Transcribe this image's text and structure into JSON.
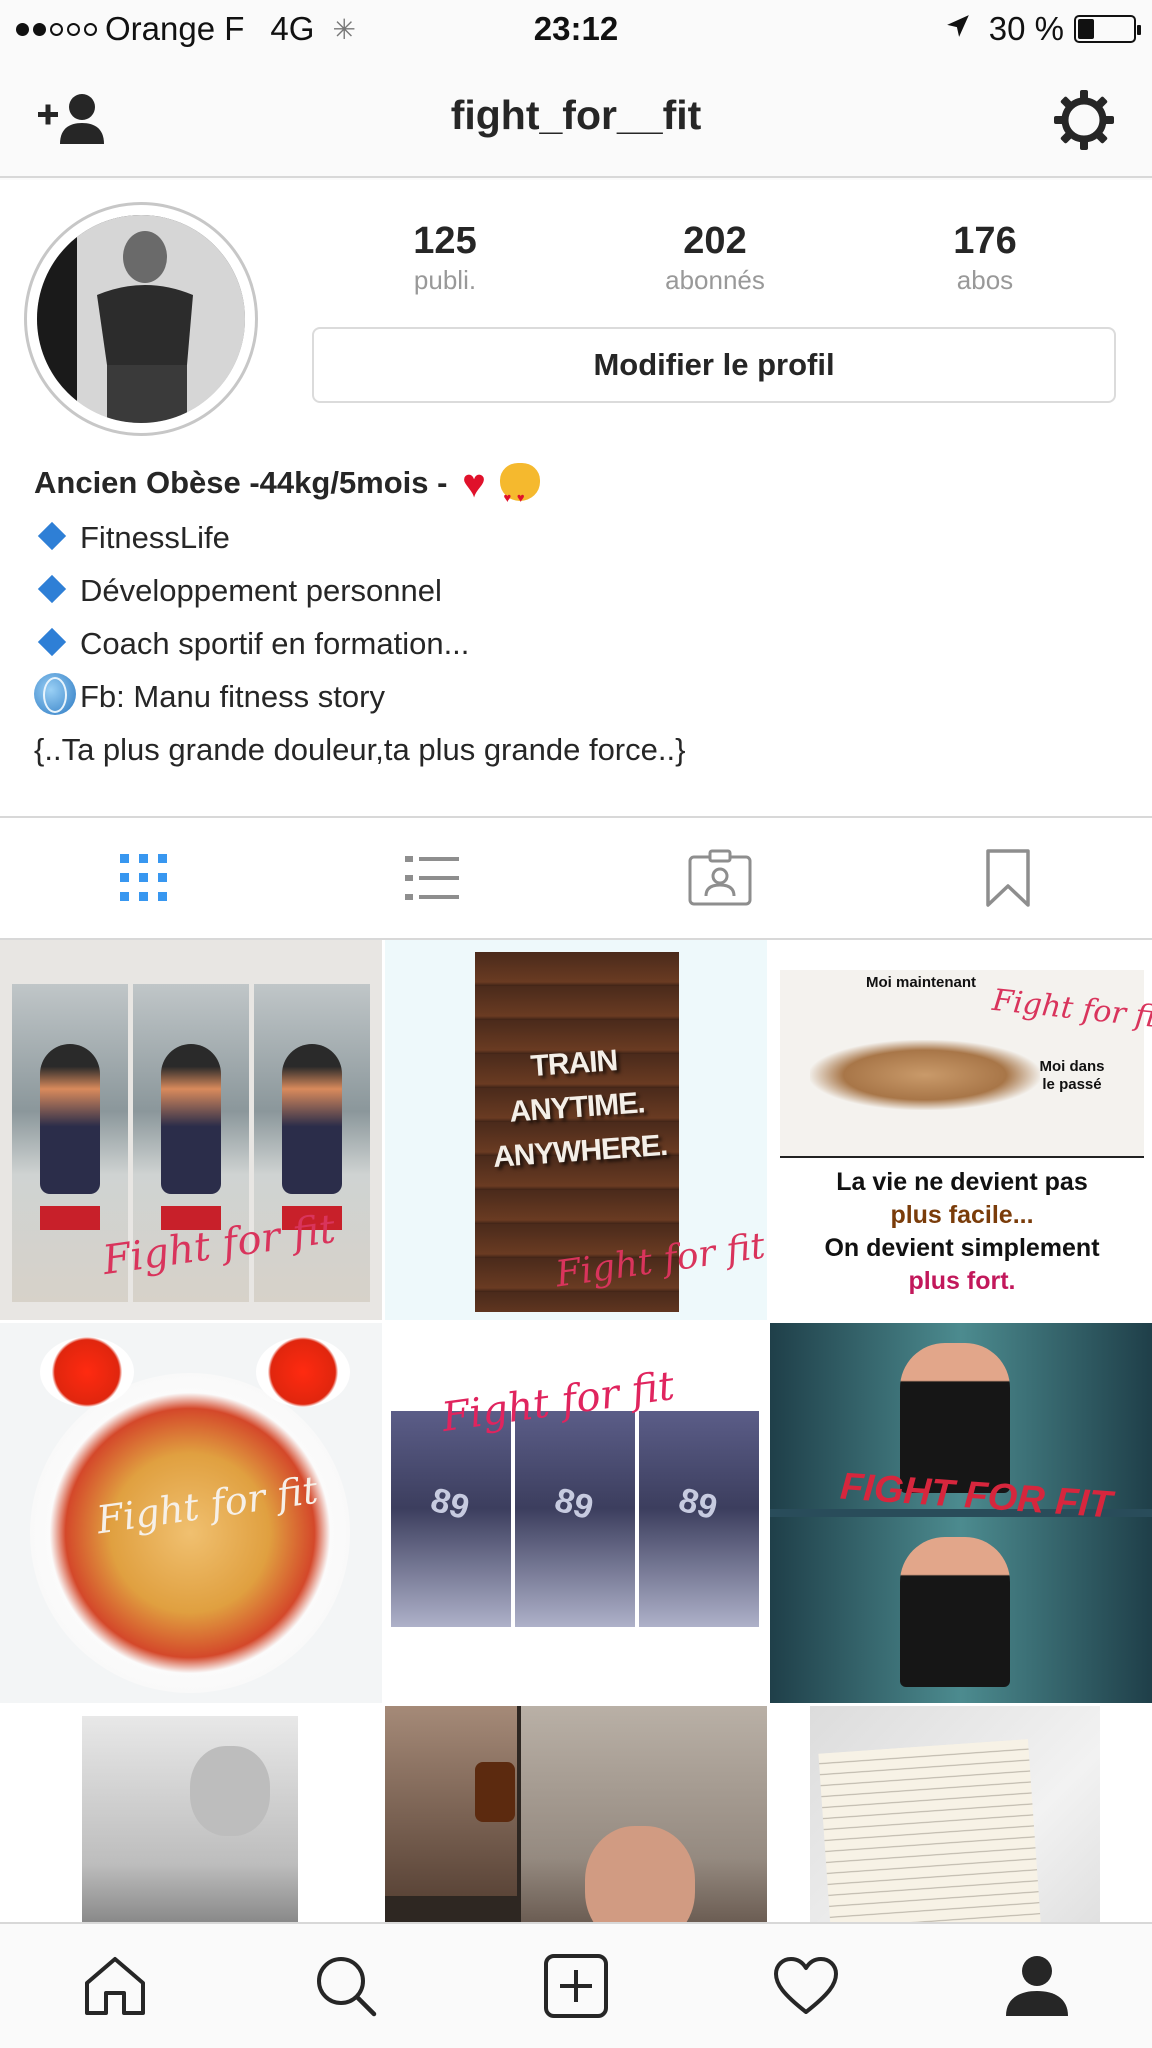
{
  "status_bar": {
    "carrier": "Orange F",
    "network": "4G",
    "time": "23:12",
    "battery": "30 %",
    "battery_level": 0.3,
    "signal_bars": 2
  },
  "header": {
    "username": "fight_for__fit",
    "left_icon": "add-user-icon",
    "right_icon": "gear-icon"
  },
  "profile": {
    "stats": [
      {
        "value": "125",
        "label": "publi."
      },
      {
        "value": "202",
        "label": "abonnés"
      },
      {
        "value": "176",
        "label": "abos"
      }
    ],
    "edit_button": "Modifier le profil",
    "bio": {
      "name_line": "Ancien Obèse -44kg/5mois -",
      "lines": [
        "FitnessLife",
        "Développement personnel",
        "Coach sportif en formation..."
      ],
      "fb_line": "Fb: Manu fitness story",
      "quote": "{..Ta plus grande douleur,ta plus grande force..}"
    }
  },
  "tabs": [
    {
      "icon": "grid-icon",
      "active": true
    },
    {
      "icon": "list-icon",
      "active": false
    },
    {
      "icon": "tagged-icon",
      "active": false
    },
    {
      "icon": "saved-bookmark-icon",
      "active": false
    }
  ],
  "posts": {
    "watermark": "Fight for fit",
    "sign_lines": [
      "TRAIN",
      "ANYTIME.",
      "ANYWHERE."
    ],
    "quote_post": {
      "top_left": "Moi maintenant",
      "top_right": "Moi dans le passé",
      "line1": "La vie ne devient pas",
      "line2": "plus facile...",
      "line3": "On devient simplement",
      "line4": "plus fort."
    },
    "fight_caps": "FIGHT FOR FIT"
  },
  "bottom_bar": [
    {
      "icon": "home-icon"
    },
    {
      "icon": "search-icon"
    },
    {
      "icon": "new-post-icon"
    },
    {
      "icon": "heart-icon"
    },
    {
      "icon": "profile-icon",
      "active": true
    }
  ],
  "colors": {
    "accent_blue": "#3897f0",
    "text": "#262626",
    "muted": "#999999",
    "watermark_pink": "#d9345c"
  }
}
